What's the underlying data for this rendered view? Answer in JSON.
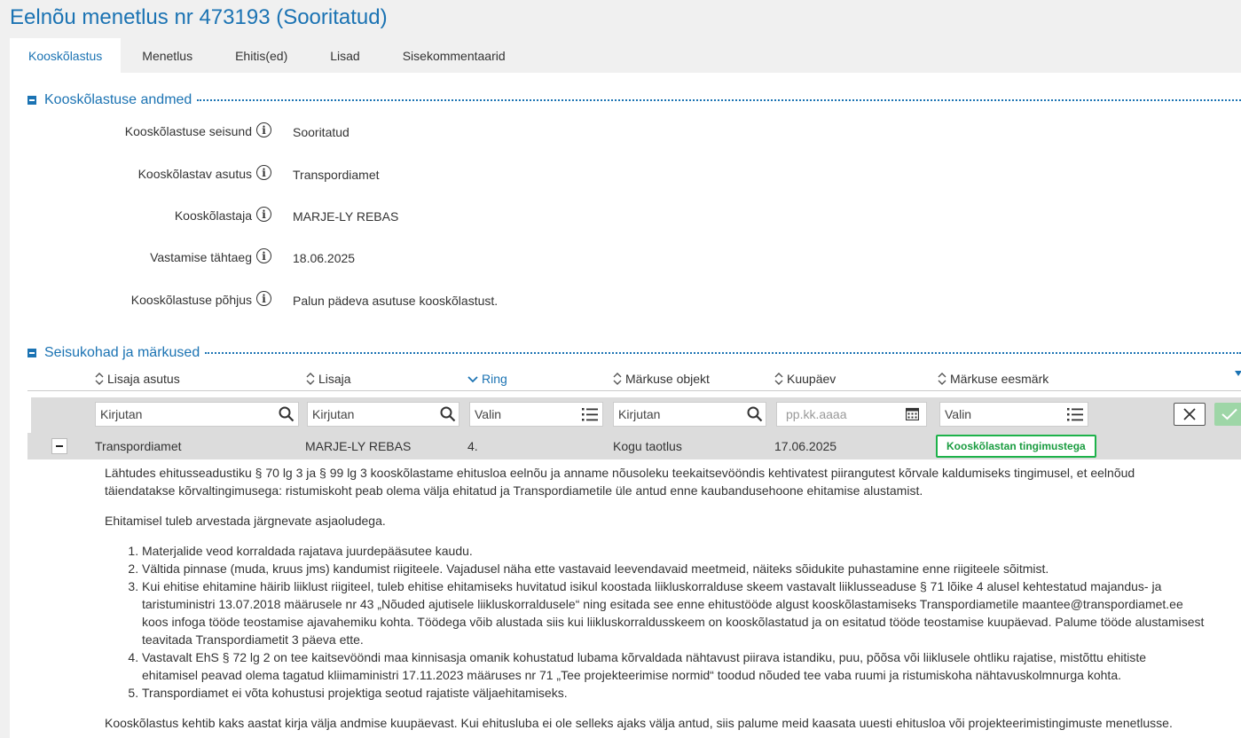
{
  "page": {
    "title": "Eelnõu menetlus nr 473193 (Sooritatud)"
  },
  "tabs": [
    {
      "label": "Kooskõlastus",
      "active": true
    },
    {
      "label": "Menetlus"
    },
    {
      "label": "Ehitis(ed)"
    },
    {
      "label": "Lisad"
    },
    {
      "label": "Sisekommentaarid"
    }
  ],
  "section1": {
    "title": "Kooskõlastuse andmed",
    "fields": [
      {
        "label": "Kooskõlastuse seisund",
        "value": "Sooritatud"
      },
      {
        "label": "Kooskõlastav asutus",
        "value": "Transpordiamet"
      },
      {
        "label": "Kooskõlastaja",
        "value": "MARJE-LY REBAS"
      },
      {
        "label": "Vastamise tähtaeg",
        "value": "18.06.2025"
      },
      {
        "label": "Kooskõlastuse põhjus",
        "value": "Palun pädeva asutuse kooskõlastust."
      }
    ]
  },
  "section2": {
    "title": "Seisukohad ja märkused",
    "columns": [
      "Lisaja asutus",
      "Lisaja",
      "Ring",
      "Märkuse objekt",
      "Kuupäev",
      "Märkuse eesmärk"
    ],
    "sorted_column": "Ring",
    "filters": {
      "lisaja_asutus": "Kirjutan",
      "lisaja": "Kirjutan",
      "ring": "Valin",
      "objekt": "Kirjutan",
      "kuupaev": "pp.kk.aaaa",
      "eesmark": "Valin"
    },
    "row": {
      "asutus": "Transpordiamet",
      "lisaja": "MARJE-LY REBAS",
      "ring": "4.",
      "objekt": "Kogu taotlus",
      "kuupaev": "17.06.2025",
      "eesmark": "Kooskõlastan tingimustega"
    },
    "detail": {
      "intro": "Lähtudes ehitusseadustiku § 70 lg 3 ja § 99 lg 3 kooskõlastame ehitusloa eelnõu ja anname nõusoleku teekaitsevööndis kehtivatest piirangutest kõrvale kaldumiseks tingimusel, et eelnõud täiendatakse kõrvaltingimusega: ristumiskoht peab olema välja ehitatud ja Transpordiametile üle antud enne kaubandusehoone ehitamise alustamist.",
      "lead": "Ehitamisel tuleb arvestada järgnevate asjaoludega.",
      "items": [
        "Materjalide veod korraldada rajatava juurdepääsutee kaudu.",
        "Vältida pinnase (muda, kruus jms) kandumist riigiteele. Vajadusel näha ette vastavaid leevendavaid meetmeid, näiteks sõidukite puhastamine enne riigiteele sõitmist.",
        "Kui ehitise ehitamine häirib liiklust riigiteel, tuleb ehitise ehitamiseks huvitatud isikul koostada liikluskorralduse skeem vastavalt liiklusseaduse § 71 lõike 4 alusel kehtestatud majandus- ja taristuministri 13.07.2018 määrusele nr 43 „Nõuded ajutisele liikluskorraldusele“ ning esitada see enne ehitustööde algust kooskõlastamiseks Transpordiametile maantee@transpordiamet.ee koos infoga tööde teostamise ajavahemiku kohta. Töödega võib alustada siis kui liikluskorraldusskeem on kooskõlastatud ja on esitatud tööde teostamise kuupäevad. Palume tööde alustamisest teavitada Transpordiametit 3 päeva ette.",
        "Vastavalt EhS § 72 lg 2 on tee kaitsevööndi maa kinnisasja omanik kohustatud lubama kõrvaldada nähtavust piirava istandiku, puu, põõsa või liiklusele ohtliku rajatise, mistõttu ehitiste ehitamisel peavad olema tagatud kliimaministri 17.11.2023 määruses nr 71 „Tee projekteerimise normid“ toodud nõuded tee vaba ruumi ja ristumiskoha nähtavuskolmnurga kohta.",
        "Transpordiamet ei võta kohustusi projektiga seotud rajatiste väljaehitamiseks."
      ],
      "footer": "Kooskõlastus kehtib kaks aastat kirja välja andmise kuupäevast. Kui ehitusluba ei ole selleks ajaks välja antud, siis palume meid kaasata uuesti ehitusloa või projekteerimistingimuste menetlusse."
    }
  },
  "colors": {
    "accent": "#1b73b3",
    "success": "#1db24a",
    "header_bg": "#dcdcdc"
  },
  "icons": [
    "info-icon",
    "search-icon",
    "list-icon",
    "calendar-icon",
    "close-icon",
    "check-icon",
    "sort-icon",
    "collapse-icon"
  ]
}
